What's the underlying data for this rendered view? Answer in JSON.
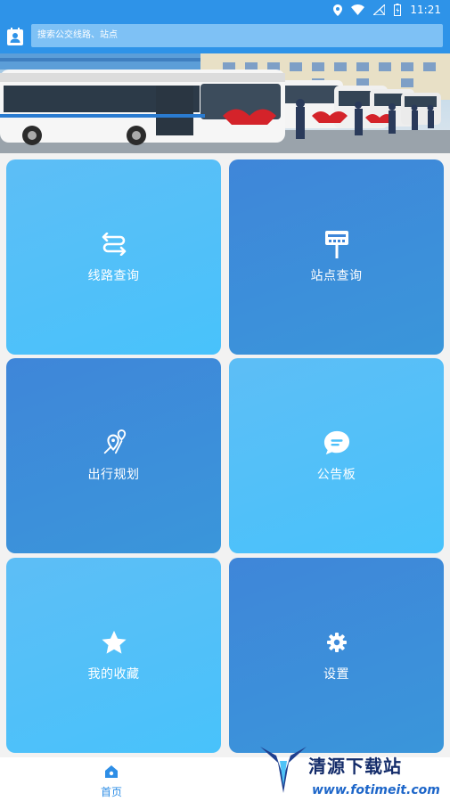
{
  "status_bar": {
    "time": "11:21"
  },
  "search": {
    "placeholder": "搜索公交线路、站点"
  },
  "tiles": [
    {
      "label": "线路查询",
      "icon": "route-swap-icon",
      "style": "light"
    },
    {
      "label": "站点查询",
      "icon": "bus-stop-sign-icon",
      "style": "dark"
    },
    {
      "label": "出行规划",
      "icon": "map-pin-route-icon",
      "style": "dark"
    },
    {
      "label": "公告板",
      "icon": "message-bubble-icon",
      "style": "light"
    },
    {
      "label": "我的收藏",
      "icon": "star-icon",
      "style": "light"
    },
    {
      "label": "设置",
      "icon": "gear-icon",
      "style": "dark"
    }
  ],
  "bottom_nav": {
    "home_label": "首页"
  },
  "watermark": {
    "title": "清源下载站",
    "url": "www.fotimeit.com"
  },
  "colors": {
    "primary": "#2e93e8",
    "tile_light": "#4cc0fa",
    "tile_dark": "#3d8ada"
  }
}
